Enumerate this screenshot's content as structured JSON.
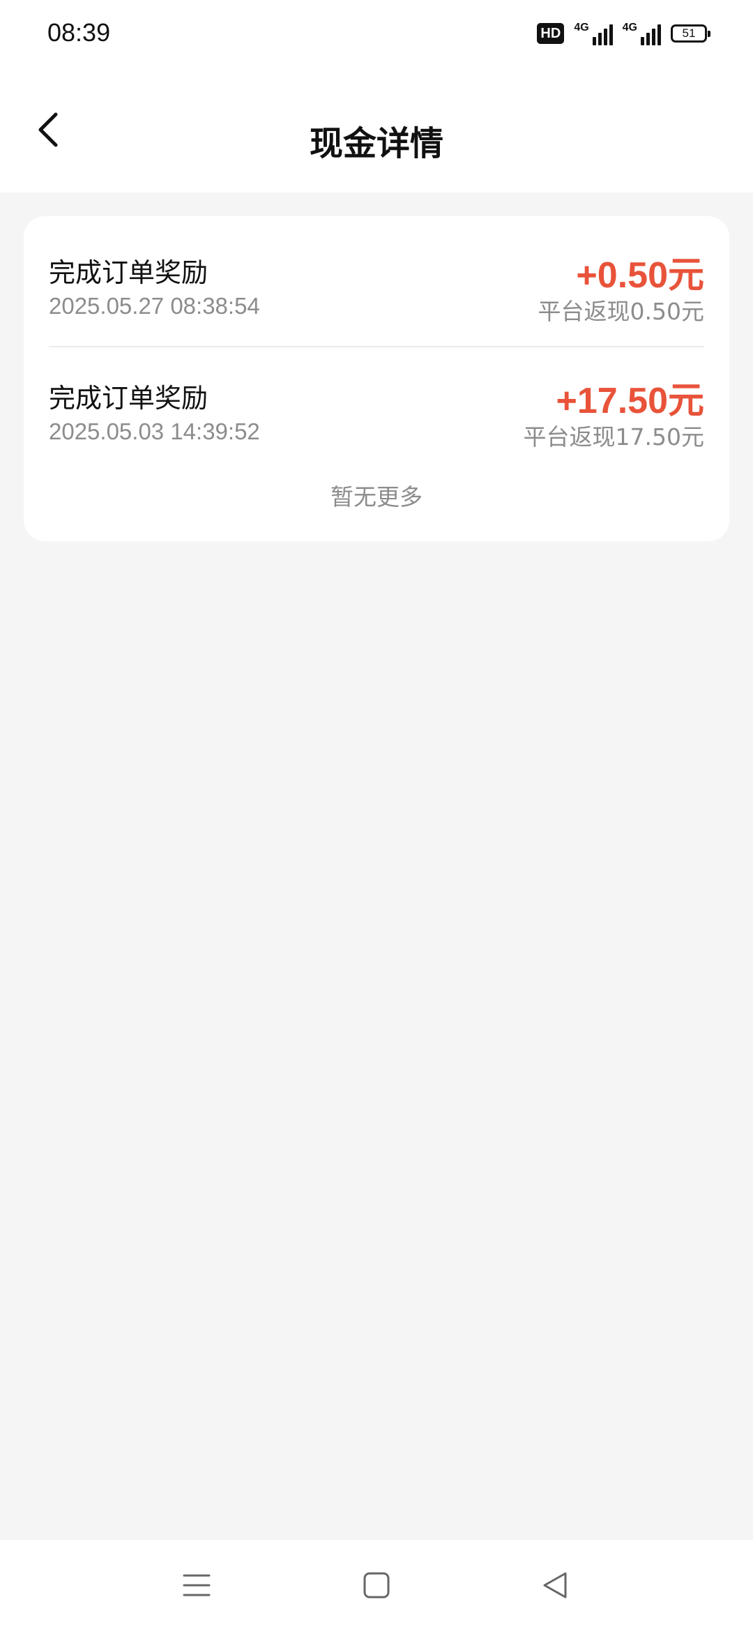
{
  "status_bar": {
    "time": "08:39",
    "hd_label": "HD",
    "network_1": "4G",
    "network_2": "4G",
    "battery_level": "51"
  },
  "header": {
    "title": "现金详情",
    "back_icon": "chevron-left-icon"
  },
  "records": [
    {
      "title": "完成订单奖励",
      "time": "2025.05.27 08:38:54",
      "amount": "+0.50元",
      "description": "平台返现0.50元"
    },
    {
      "title": "完成订单奖励",
      "time": "2025.05.03 14:39:52",
      "amount": "+17.50元",
      "description": "平台返现17.50元"
    }
  ],
  "footer_text": "暂无更多",
  "nav_bar": {
    "menu_icon": "menu-icon",
    "home_icon": "home-square-icon",
    "back_icon": "back-triangle-icon"
  },
  "colors": {
    "amount": "#e8533a",
    "background": "#f5f5f5"
  }
}
